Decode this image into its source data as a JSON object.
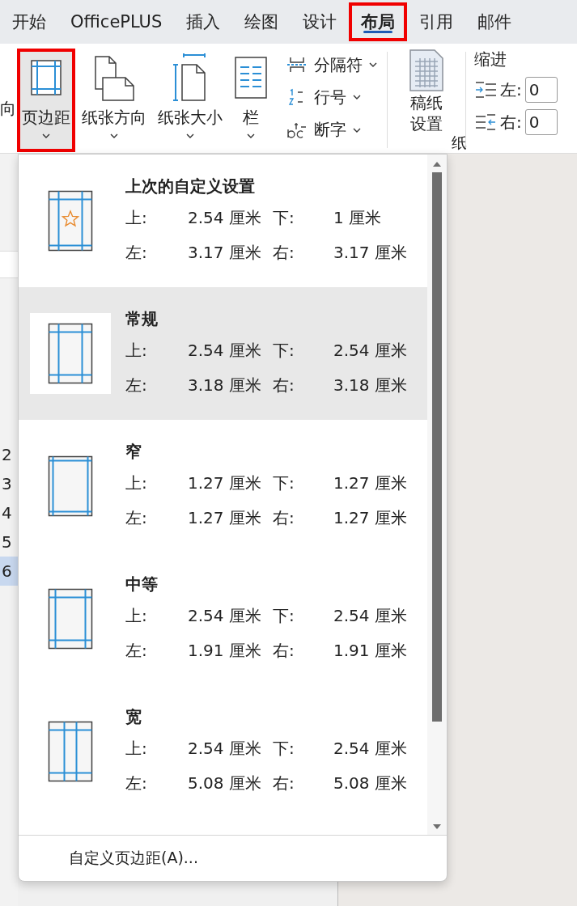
{
  "tabs": [
    {
      "label": "开始",
      "selected": false,
      "highlighted": false
    },
    {
      "label": "OfficePLUS",
      "selected": false,
      "highlighted": false
    },
    {
      "label": "插入",
      "selected": false,
      "highlighted": false
    },
    {
      "label": "绘图",
      "selected": false,
      "highlighted": false
    },
    {
      "label": "设计",
      "selected": false,
      "highlighted": false
    },
    {
      "label": "布局",
      "selected": true,
      "highlighted": true
    },
    {
      "label": "引用",
      "selected": false,
      "highlighted": false
    },
    {
      "label": "邮件",
      "selected": false,
      "highlighted": false
    }
  ],
  "ribbon": {
    "cut_label": "向",
    "large_buttons": [
      {
        "kind": "margins",
        "label": "页边距",
        "pressed": true,
        "highlighted": true
      },
      {
        "kind": "orientation",
        "label": "纸张方向",
        "pressed": false,
        "highlighted": false
      },
      {
        "kind": "size",
        "label": "纸张大小",
        "pressed": false,
        "highlighted": false
      },
      {
        "kind": "columns",
        "label": "栏",
        "pressed": false,
        "highlighted": false
      }
    ],
    "small_buttons": [
      {
        "kind": "breaks",
        "label": "分隔符"
      },
      {
        "kind": "line_numbers",
        "label": "行号"
      },
      {
        "kind": "hyphenation",
        "label": "断字"
      }
    ],
    "draft_button": {
      "label": "稿纸设置",
      "group_label": "纸"
    },
    "indent": {
      "title": "缩进",
      "left_label": "左:",
      "left_value": "0",
      "right_label": "右:",
      "right_value": "0"
    }
  },
  "nav_pane": {
    "items": [
      {
        "label": "2",
        "selected": false
      },
      {
        "label": "3",
        "selected": false
      },
      {
        "label": "4",
        "selected": false
      },
      {
        "label": "5",
        "selected": false
      },
      {
        "label": "6",
        "selected": true
      }
    ]
  },
  "margins_menu": {
    "items": [
      {
        "kind": "custom",
        "title": "上次的自定义设置",
        "selected": false,
        "top_label": "上:",
        "top": "2.54 厘米",
        "bottom_label": "下:",
        "bottom": "1 厘米",
        "left_label": "左:",
        "left": "3.17 厘米",
        "right_label": "右:",
        "right": "3.17 厘米"
      },
      {
        "kind": "normal",
        "title": "常规",
        "selected": true,
        "top_label": "上:",
        "top": "2.54 厘米",
        "bottom_label": "下:",
        "bottom": "2.54 厘米",
        "left_label": "左:",
        "left": "3.18 厘米",
        "right_label": "右:",
        "right": "3.18 厘米"
      },
      {
        "kind": "narrow",
        "title": "窄",
        "selected": false,
        "top_label": "上:",
        "top": "1.27 厘米",
        "bottom_label": "下:",
        "bottom": "1.27 厘米",
        "left_label": "左:",
        "left": "1.27 厘米",
        "right_label": "右:",
        "right": "1.27 厘米"
      },
      {
        "kind": "moderate",
        "title": "中等",
        "selected": false,
        "top_label": "上:",
        "top": "2.54 厘米",
        "bottom_label": "下:",
        "bottom": "2.54 厘米",
        "left_label": "左:",
        "left": "1.91 厘米",
        "right_label": "右:",
        "right": "1.91 厘米"
      },
      {
        "kind": "wide",
        "title": "宽",
        "selected": false,
        "top_label": "上:",
        "top": "2.54 厘米",
        "bottom_label": "下:",
        "bottom": "2.54 厘米",
        "left_label": "左:",
        "left": "5.08 厘米",
        "right_label": "右:",
        "right": "5.08 厘米"
      }
    ],
    "footer": "自定义页边距(A)..."
  }
}
